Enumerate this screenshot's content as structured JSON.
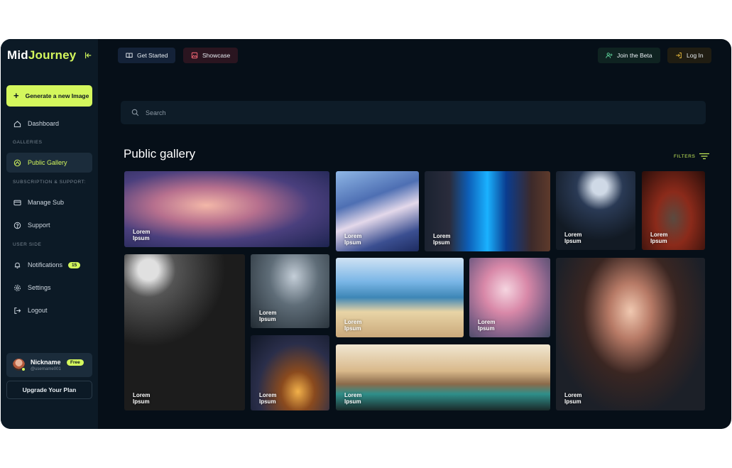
{
  "logo": {
    "part1": "Mid",
    "part2": "Journey"
  },
  "sidebar": {
    "generate_label": "Generate a new Image",
    "dashboard": "Dashboard",
    "galleries_heading": "GALLERIES",
    "public_gallery": "Public Gallery",
    "subscription_heading": "SUBSCRIPTION & SUPPORT:",
    "manage_sub": "Manage Sub",
    "support": "Support",
    "user_side_heading": "USER SIDE",
    "notifications": "Notifications",
    "notifications_count": "15",
    "settings": "Settings",
    "logout": "Logout"
  },
  "user": {
    "nickname": "Nickname",
    "username": "@username001",
    "plan_badge": "Free"
  },
  "upgrade_label": "Upgrade Your Plan",
  "topbar": {
    "get_started": "Get Started",
    "showcase": "Showcase",
    "join_beta": "Join the Beta",
    "login": "Log In"
  },
  "search": {
    "placeholder": "Search"
  },
  "gallery": {
    "title": "Public gallery",
    "filters": "FILTERS",
    "caption_line1": "Lorem",
    "caption_line2": "Ipsum"
  },
  "colors": {
    "accent": "#d4f75d",
    "background": "#060f18",
    "sidebar": "#0c1a26"
  }
}
